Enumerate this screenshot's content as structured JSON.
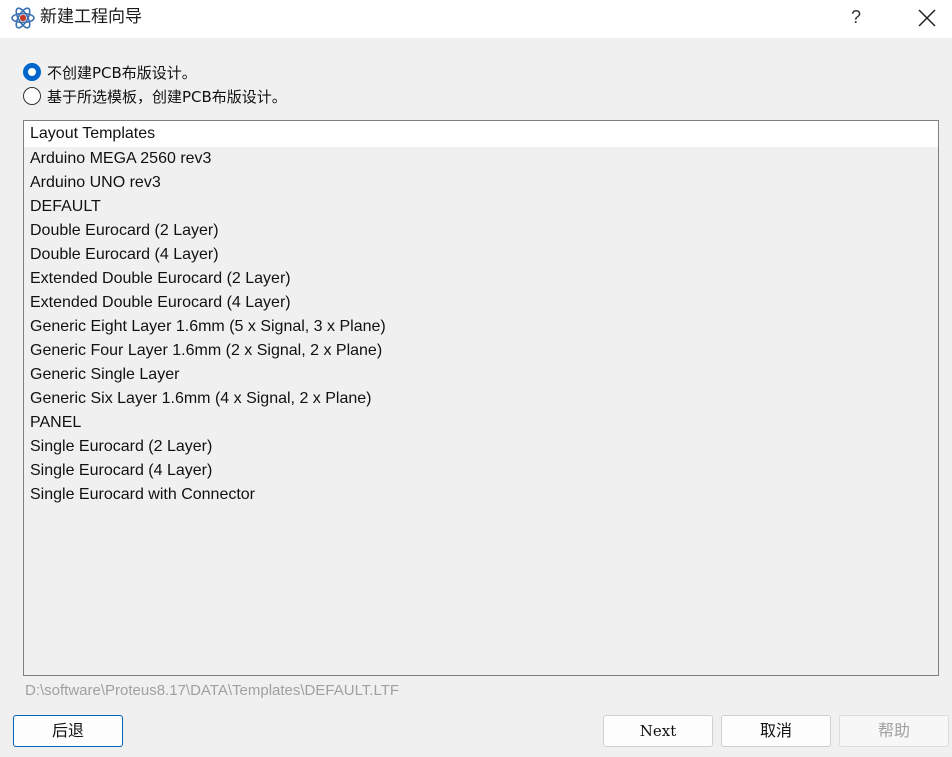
{
  "window": {
    "title": "新建工程向导",
    "help_symbol": "?",
    "icon": "proteus-atom-icon"
  },
  "options": [
    {
      "label": "不创建PCB布版设计。",
      "checked": true
    },
    {
      "label": "基于所选模板，创建PCB布版设计。",
      "checked": false
    }
  ],
  "templates": {
    "header": "Layout Templates",
    "items": [
      "Arduino MEGA 2560 rev3",
      "Arduino UNO rev3",
      "DEFAULT",
      "Double Eurocard (2 Layer)",
      "Double Eurocard (4 Layer)",
      "Extended Double Eurocard (2 Layer)",
      "Extended Double Eurocard (4 Layer)",
      "Generic Eight Layer 1.6mm (5 x Signal, 3 x Plane)",
      "Generic Four Layer 1.6mm (2 x Signal, 2 x Plane)",
      "Generic Single Layer",
      "Generic Six Layer 1.6mm (4 x Signal, 2 x Plane)",
      "PANEL",
      "Single Eurocard (2 Layer)",
      "Single Eurocard (4 Layer)",
      "Single Eurocard with Connector"
    ]
  },
  "path": "D:\\software\\Proteus8.17\\DATA\\Templates\\DEFAULT.LTF",
  "buttons": {
    "back": "后退",
    "next": "Next",
    "cancel": "取消",
    "help": "帮助"
  },
  "colors": {
    "accent": "#0066cc",
    "disabled_text": "#a0a0a0"
  }
}
